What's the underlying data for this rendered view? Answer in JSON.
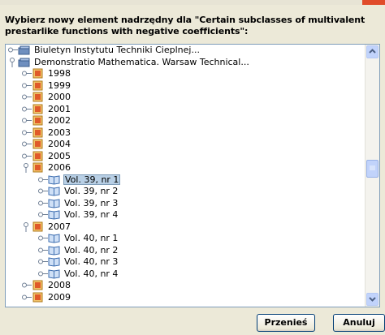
{
  "dialog": {
    "prompt": "Wybierz nowy element nadrzędny dla \"Certain subclasses of multivalent prestarlike functions with negative coefficients\":",
    "buttons": {
      "move": "Przenieś",
      "cancel": "Anuluj"
    },
    "colors": {
      "background": "#ece9d8",
      "selection": "#b8cfe5",
      "border": "#7f9db9"
    }
  },
  "tree": {
    "rows": [
      {
        "label": "Biuletyn Instytutu Techniki Cieplnej...",
        "icon": "collection-icon",
        "expanded": false,
        "selected": false
      },
      {
        "label": "Demonstratio Mathematica. Warsaw Technical...",
        "icon": "collection-icon",
        "expanded": true,
        "selected": false
      },
      {
        "label": "1998",
        "icon": "year-folder-icon",
        "expanded": false,
        "selected": false
      },
      {
        "label": "1999",
        "icon": "year-folder-icon",
        "expanded": false,
        "selected": false
      },
      {
        "label": "2000",
        "icon": "year-folder-icon",
        "expanded": false,
        "selected": false
      },
      {
        "label": "2001",
        "icon": "year-folder-icon",
        "expanded": false,
        "selected": false
      },
      {
        "label": "2002",
        "icon": "year-folder-icon",
        "expanded": false,
        "selected": false
      },
      {
        "label": "2003",
        "icon": "year-folder-icon",
        "expanded": false,
        "selected": false
      },
      {
        "label": "2004",
        "icon": "year-folder-icon",
        "expanded": false,
        "selected": false
      },
      {
        "label": "2005",
        "icon": "year-folder-icon",
        "expanded": false,
        "selected": false
      },
      {
        "label": "2006",
        "icon": "year-folder-icon",
        "expanded": true,
        "selected": false
      },
      {
        "label": "Vol. 39, nr 1",
        "icon": "book-icon",
        "expanded": false,
        "selected": true
      },
      {
        "label": "Vol. 39, nr 2",
        "icon": "book-icon",
        "expanded": false,
        "selected": false
      },
      {
        "label": "Vol. 39, nr 3",
        "icon": "book-icon",
        "expanded": false,
        "selected": false
      },
      {
        "label": "Vol. 39, nr 4",
        "icon": "book-icon",
        "expanded": false,
        "selected": false
      },
      {
        "label": "2007",
        "icon": "year-folder-icon",
        "expanded": true,
        "selected": false
      },
      {
        "label": "Vol. 40, nr 1",
        "icon": "book-icon",
        "expanded": false,
        "selected": false
      },
      {
        "label": "Vol. 40, nr 2",
        "icon": "book-icon",
        "expanded": false,
        "selected": false
      },
      {
        "label": "Vol. 40, nr 3",
        "icon": "book-icon",
        "expanded": false,
        "selected": false
      },
      {
        "label": "Vol. 40, nr 4",
        "icon": "book-icon",
        "expanded": false,
        "selected": false
      },
      {
        "label": "2008",
        "icon": "year-folder-icon",
        "expanded": false,
        "selected": false
      },
      {
        "label": "2009",
        "icon": "year-folder-icon",
        "expanded": false,
        "selected": false
      }
    ]
  }
}
